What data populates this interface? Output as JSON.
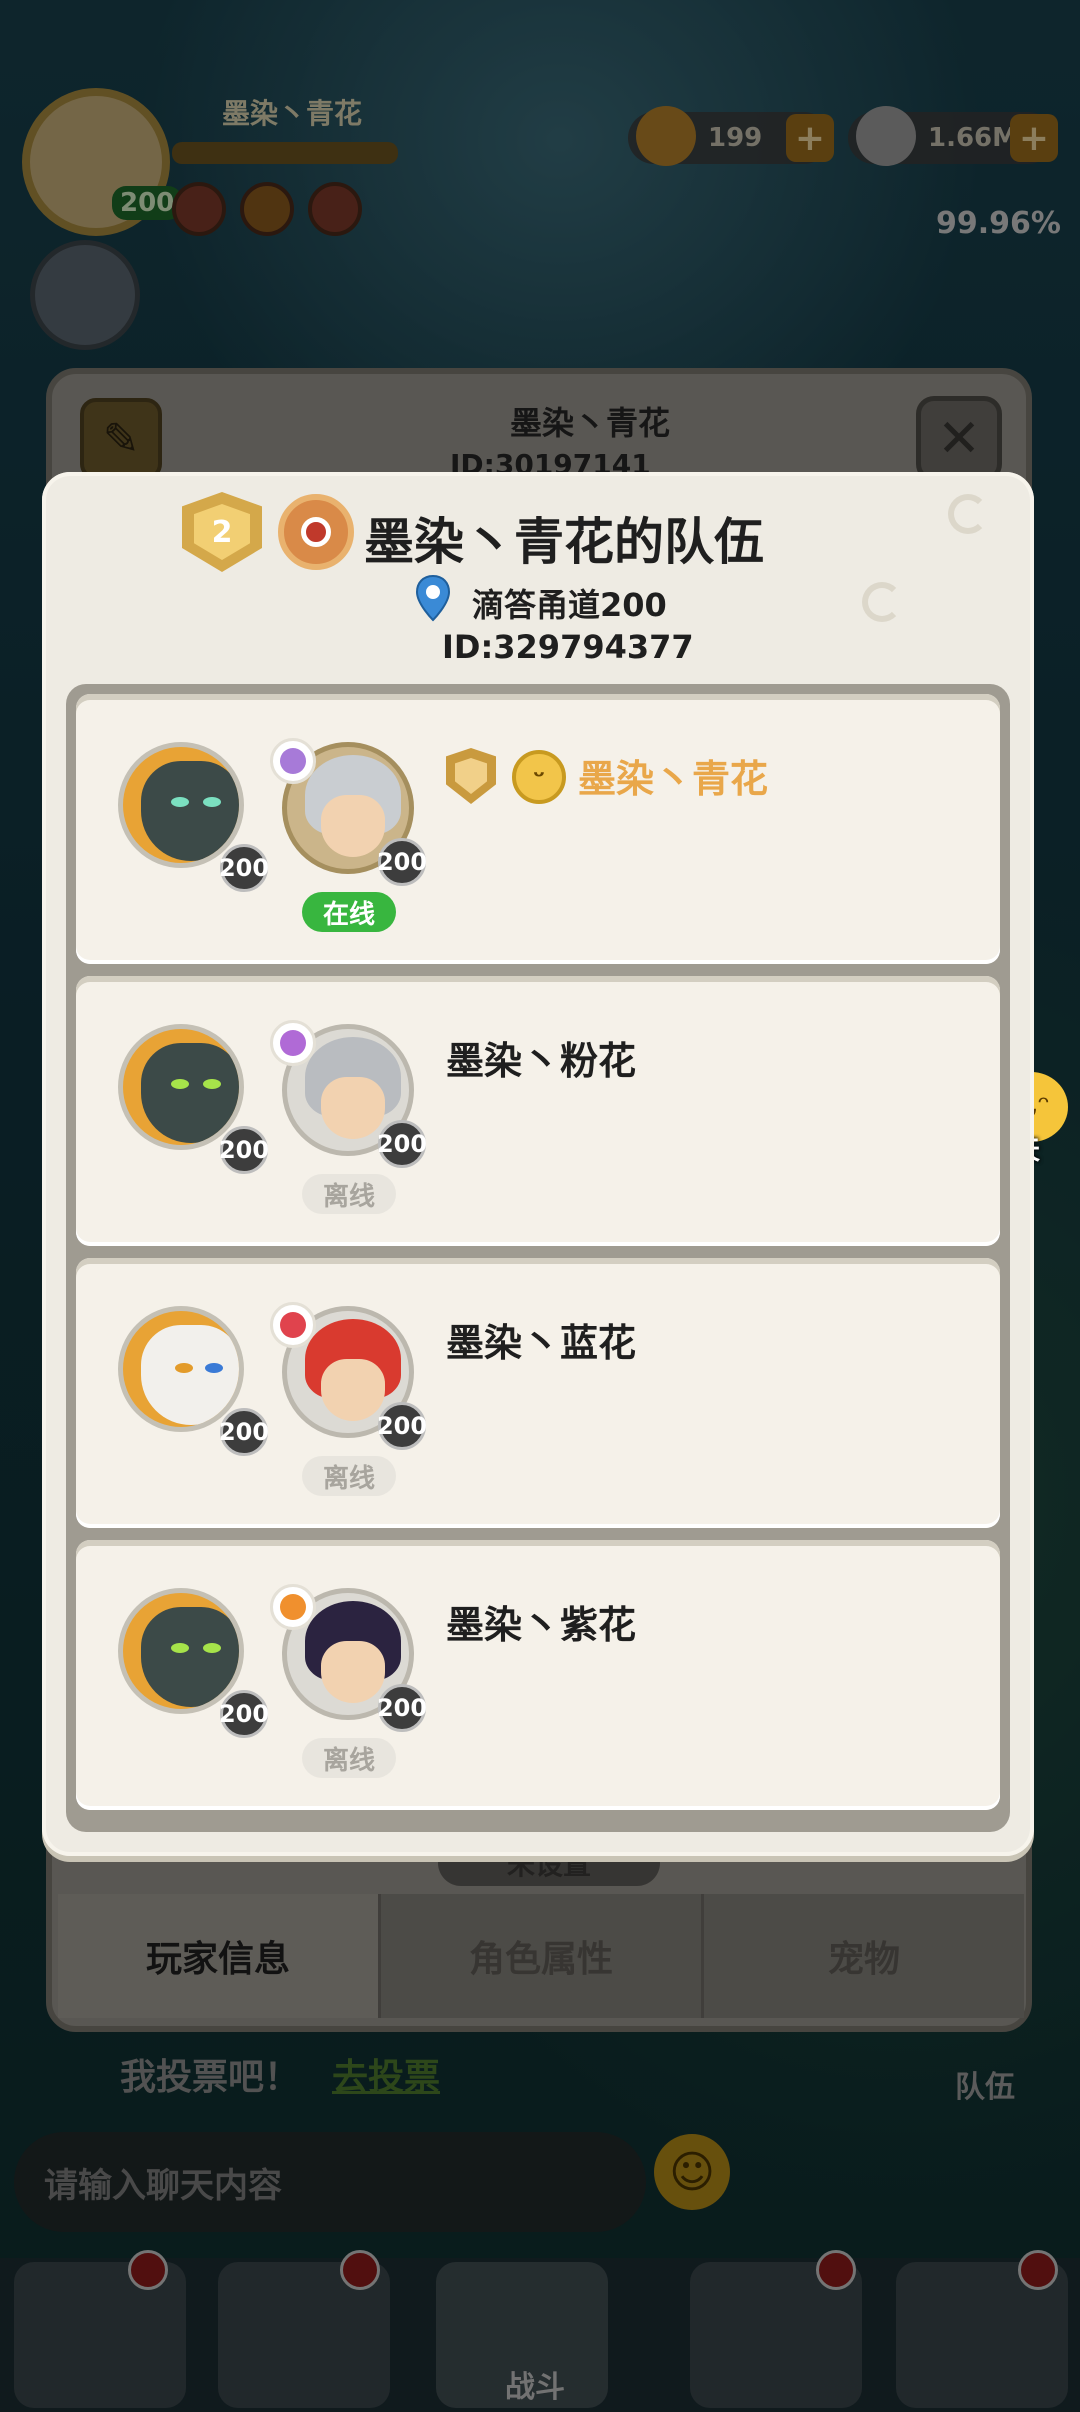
{
  "background": {
    "hud": {
      "player_name": "墨染丶青花",
      "player_level": "200",
      "currency_1": "199",
      "currency_2": "1.66M",
      "plus_symbol": "+",
      "progress_percent": "99.96%"
    },
    "profile_panel": {
      "name": "墨染丶青花",
      "id_partial": "ID:30197141",
      "unset_label": "未设置",
      "tabs": [
        "玩家信息",
        "角色属性",
        "宠物"
      ],
      "active_tab": 0,
      "close_symbol": "✕"
    },
    "vote_prompt": "我投票吧！",
    "vote_link": "去投票",
    "chat_placeholder": "请输入聊天内容",
    "team_button_label": "队伍",
    "battle_label": "战斗",
    "chat_bubble_label": "聊天"
  },
  "team_modal": {
    "rank_badge_value": "2",
    "title": "墨染丶青花的队伍",
    "location": "滴答甬道200",
    "team_id": "ID:329794377",
    "members": [
      {
        "name": "墨染丶青花",
        "is_leader": true,
        "pet_level": "200",
        "char_level": "200",
        "status": "在线",
        "online": true
      },
      {
        "name": "墨染丶粉花",
        "is_leader": false,
        "pet_level": "200",
        "char_level": "200",
        "status": "离线",
        "online": false
      },
      {
        "name": "墨染丶蓝花",
        "is_leader": false,
        "pet_level": "200",
        "char_level": "200",
        "status": "离线",
        "online": false
      },
      {
        "name": "墨染丶紫花",
        "is_leader": false,
        "pet_level": "200",
        "char_level": "200",
        "status": "离线",
        "online": false
      }
    ]
  },
  "colors": {
    "online_green": "#38b63f",
    "leader_gold": "#e9a74a",
    "modal_bg": "#eeebe3"
  },
  "icons": {
    "pin": "location-pin-icon",
    "rank": "rank-badge-icon",
    "pet_emblem": "pokeball-emblem-icon",
    "leader": "leader-shield-icon",
    "emoji": "smiley-icon"
  }
}
